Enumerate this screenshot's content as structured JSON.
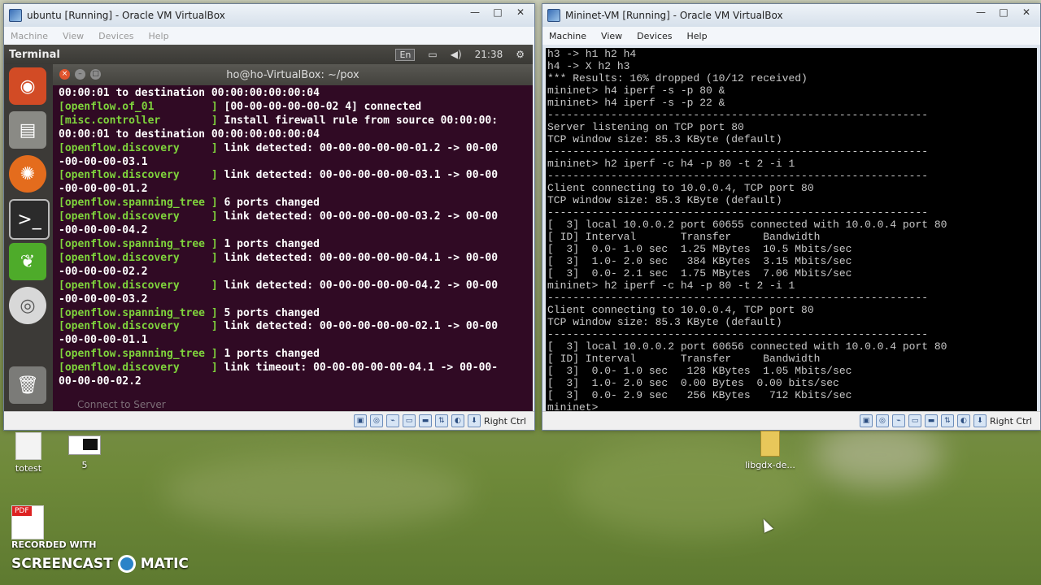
{
  "colors": {
    "terminal_bg": "#300a24",
    "terminal_green": "#7fd43c",
    "mininet_bg": "#000000",
    "mininet_text": "#c8c8c8"
  },
  "left_window": {
    "title": "ubuntu [Running] - Oracle VM VirtualBox",
    "menu": [
      "Machine",
      "View",
      "Devices",
      "Help"
    ],
    "guest": {
      "top_label": "Terminal",
      "keyboard": "En",
      "clock": "21:38",
      "launcher_icons": [
        "ubuntu-icon",
        "files-icon",
        "firefox-icon",
        "terminal-icon",
        "leaf-icon",
        "disc-icon",
        "trash-icon"
      ],
      "terminal": {
        "title": "ho@ho-VirtualBox: ~/pox",
        "lines": [
          {
            "tag": "",
            "text": "00:00:01 to destination 00:00:00:00:00:04"
          },
          {
            "tag": "[openflow.of_01         ]",
            "text": " [00-00-00-00-00-02 4] connected"
          },
          {
            "tag": "[misc.controller        ]",
            "text": " Install firewall rule from source 00:00:00:"
          },
          {
            "tag": "",
            "text": "00:00:01 to destination 00:00:00:00:00:04"
          },
          {
            "tag": "[openflow.discovery     ]",
            "text": " link detected: 00-00-00-00-00-01.2 -> 00-00"
          },
          {
            "tag": "",
            "text": "-00-00-00-03.1"
          },
          {
            "tag": "[openflow.discovery     ]",
            "text": " link detected: 00-00-00-00-00-03.1 -> 00-00"
          },
          {
            "tag": "",
            "text": "-00-00-00-01.2"
          },
          {
            "tag": "[openflow.spanning_tree ]",
            "text": " 6 ports changed"
          },
          {
            "tag": "[openflow.discovery     ]",
            "text": " link detected: 00-00-00-00-00-03.2 -> 00-00"
          },
          {
            "tag": "",
            "text": "-00-00-00-04.2"
          },
          {
            "tag": "[openflow.spanning_tree ]",
            "text": " 1 ports changed"
          },
          {
            "tag": "[openflow.discovery     ]",
            "text": " link detected: 00-00-00-00-00-04.1 -> 00-00"
          },
          {
            "tag": "",
            "text": "-00-00-00-02.2"
          },
          {
            "tag": "[openflow.discovery     ]",
            "text": " link detected: 00-00-00-00-00-04.2 -> 00-00"
          },
          {
            "tag": "",
            "text": "-00-00-00-03.2"
          },
          {
            "tag": "[openflow.spanning_tree ]",
            "text": " 5 ports changed"
          },
          {
            "tag": "[openflow.discovery     ]",
            "text": " link detected: 00-00-00-00-00-02.1 -> 00-00"
          },
          {
            "tag": "",
            "text": "-00-00-00-01.1"
          },
          {
            "tag": "[openflow.spanning_tree ]",
            "text": " 1 ports changed"
          },
          {
            "tag": "[openflow.discovery     ]",
            "text": " link timeout: 00-00-00-00-00-04.1 -> 00-00-"
          },
          {
            "tag": "",
            "text": "00-00-00-02.2"
          }
        ],
        "ghost_text": "Connect to Server"
      }
    },
    "status_text": "Right Ctrl"
  },
  "right_window": {
    "title": "Mininet-VM [Running] - Oracle VM VirtualBox",
    "menu": [
      "Machine",
      "View",
      "Devices",
      "Help"
    ],
    "console_lines": [
      "h3 -> h1 h2 h4",
      "h4 -> X h2 h3",
      "*** Results: 16% dropped (10/12 received)",
      "mininet> h4 iperf -s -p 80 &",
      "mininet> h4 iperf -s -p 22 &",
      "------------------------------------------------------------",
      "Server listening on TCP port 80",
      "TCP window size: 85.3 KByte (default)",
      "------------------------------------------------------------",
      "mininet> h2 iperf -c h4 -p 80 -t 2 -i 1",
      "------------------------------------------------------------",
      "Client connecting to 10.0.0.4, TCP port 80",
      "TCP window size: 85.3 KByte (default)",
      "------------------------------------------------------------",
      "[  3] local 10.0.0.2 port 60655 connected with 10.0.0.4 port 80",
      "[ ID] Interval       Transfer     Bandwidth",
      "[  3]  0.0- 1.0 sec  1.25 MBytes  10.5 Mbits/sec",
      "[  3]  1.0- 2.0 sec   384 KBytes  3.15 Mbits/sec",
      "[  3]  0.0- 2.1 sec  1.75 MBytes  7.06 Mbits/sec",
      "mininet> h2 iperf -c h4 -p 80 -t 2 -i 1",
      "------------------------------------------------------------",
      "Client connecting to 10.0.0.4, TCP port 80",
      "TCP window size: 85.3 KByte (default)",
      "------------------------------------------------------------",
      "[  3] local 10.0.0.2 port 60656 connected with 10.0.0.4 port 80",
      "[ ID] Interval       Transfer     Bandwidth",
      "[  3]  0.0- 1.0 sec   128 KBytes  1.05 Mbits/sec",
      "[  3]  1.0- 2.0 sec  0.00 Bytes  0.00 bits/sec",
      "[  3]  0.0- 2.9 sec   256 KBytes   712 Kbits/sec",
      "mininet> _"
    ],
    "status_text": "Right Ctrl"
  },
  "desktop": {
    "icons": [
      {
        "label": "totest"
      },
      {
        "label": "5"
      },
      {
        "label": "libgdx-de..."
      },
      {
        "label": "PDF"
      }
    ],
    "watermark_top": "RECORDED WITH",
    "watermark_left": "SCREENCAST",
    "watermark_right": "MATIC"
  }
}
